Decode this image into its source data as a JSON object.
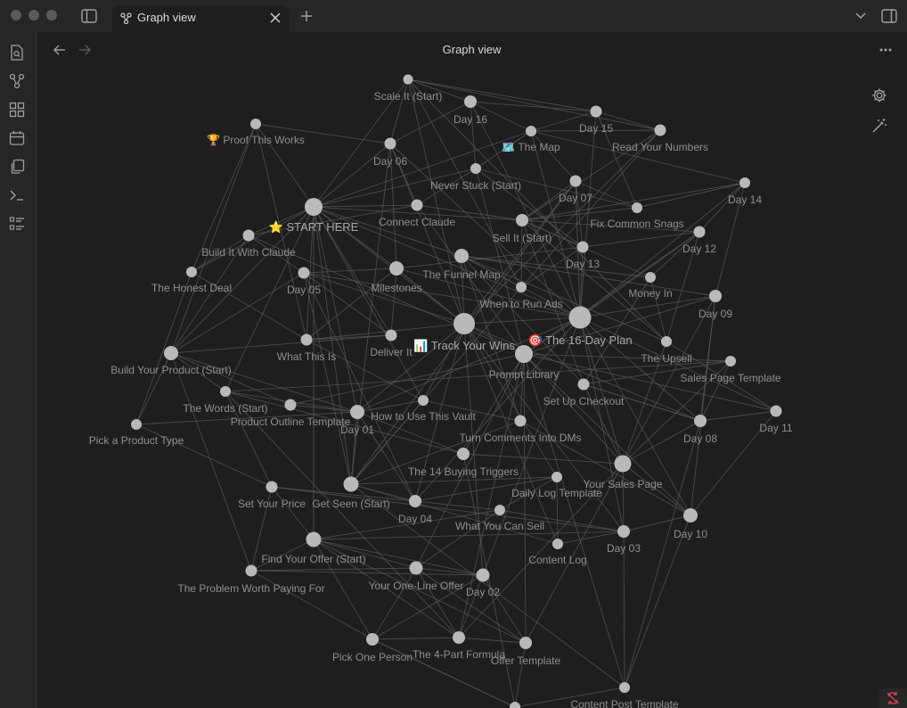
{
  "window": {
    "tab_title": "Graph view",
    "view_title": "Graph view"
  },
  "icons": {
    "tab_icon": "graph-icon",
    "close": "close-icon",
    "new_tab": "plus-icon",
    "sidebar_toggle_left": "sidebar-left-icon",
    "tab_list": "chevron-down-icon",
    "sidebar_toggle_right": "sidebar-right-icon",
    "back": "arrow-left-icon",
    "forward": "arrow-right-icon",
    "more": "more-horizontal-icon",
    "settings": "gear-icon",
    "animate": "magic-wand-icon",
    "status": "sync-off-icon"
  },
  "ribbon": [
    {
      "name": "quick-switcher",
      "icon": "file-search-icon"
    },
    {
      "name": "graph-view",
      "icon": "graph-icon"
    },
    {
      "name": "canvas",
      "icon": "grid-icon"
    },
    {
      "name": "daily-note",
      "icon": "calendar-icon"
    },
    {
      "name": "templates",
      "icon": "copy-icon"
    },
    {
      "name": "command-palette",
      "icon": "terminal-icon"
    },
    {
      "name": "bases",
      "icon": "list-icon"
    }
  ],
  "colors": {
    "background": "#1e1e1e",
    "chrome": "#262626",
    "node": "#b9b9b9",
    "edge": "#5a5a5a",
    "label": "#8f8f8f",
    "sync_off": "#e0454f"
  },
  "graph": {
    "nodes": [
      {
        "id": "scale",
        "label": "Scale It (Start)"
      },
      {
        "id": "day16",
        "label": "Day 16"
      },
      {
        "id": "day15",
        "label": "Day 15"
      },
      {
        "id": "proof",
        "label": "🏆 Proof This Works"
      },
      {
        "id": "day06",
        "label": "Day 06"
      },
      {
        "id": "map",
        "label": "🗺️ The Map"
      },
      {
        "id": "readnum",
        "label": "Read Your Numbers"
      },
      {
        "id": "neverstuck",
        "label": "Never Stuck (Start)"
      },
      {
        "id": "day07",
        "label": "Day 07"
      },
      {
        "id": "day14",
        "label": "Day 14"
      },
      {
        "id": "start",
        "label": "⭐ START HERE"
      },
      {
        "id": "connect",
        "label": "Connect Claude"
      },
      {
        "id": "sellit",
        "label": "Sell It (Start)"
      },
      {
        "id": "fixsnags",
        "label": "Fix Common Snags"
      },
      {
        "id": "buildclaude",
        "label": "Build It With Claude"
      },
      {
        "id": "day12",
        "label": "Day 12"
      },
      {
        "id": "day13",
        "label": "Day 13"
      },
      {
        "id": "honest",
        "label": "The Honest Deal"
      },
      {
        "id": "day05",
        "label": "Day 05"
      },
      {
        "id": "milestones",
        "label": "Milestones"
      },
      {
        "id": "funnel",
        "label": "The Funnel Map"
      },
      {
        "id": "moneyin",
        "label": "Money In"
      },
      {
        "id": "runads",
        "label": "When to Run Ads"
      },
      {
        "id": "day09",
        "label": "Day 09"
      },
      {
        "id": "plan",
        "label": "🎯 The 16-Day Plan"
      },
      {
        "id": "trackwins",
        "label": "📊 Track Your Wins"
      },
      {
        "id": "whatthis",
        "label": "What This Is"
      },
      {
        "id": "deliver",
        "label": "Deliver It"
      },
      {
        "id": "upsell",
        "label": "The Upsell"
      },
      {
        "id": "buildproduct",
        "label": "Build Your Product (Start)"
      },
      {
        "id": "prompt",
        "label": "Prompt Library"
      },
      {
        "id": "salespagetpl",
        "label": "Sales Page Template"
      },
      {
        "id": "checkout",
        "label": "Set Up Checkout"
      },
      {
        "id": "words",
        "label": "The Words (Start)"
      },
      {
        "id": "outline",
        "label": "Product Outline Template"
      },
      {
        "id": "vault",
        "label": "How to Use This Vault"
      },
      {
        "id": "day01",
        "label": "Day 01"
      },
      {
        "id": "day11",
        "label": "Day 11"
      },
      {
        "id": "pickproduct",
        "label": "Pick a Product Type"
      },
      {
        "id": "comments",
        "label": "Turn Comments Into DMs"
      },
      {
        "id": "day08",
        "label": "Day 08"
      },
      {
        "id": "triggers",
        "label": "The 14 Buying Triggers"
      },
      {
        "id": "yoursales",
        "label": "Your Sales Page"
      },
      {
        "id": "dailylog",
        "label": "Daily Log Template"
      },
      {
        "id": "setprice",
        "label": "Set Your Price"
      },
      {
        "id": "getseen",
        "label": "Get Seen (Start)"
      },
      {
        "id": "day04",
        "label": "Day 04"
      },
      {
        "id": "whatsell",
        "label": "What You Can Sell"
      },
      {
        "id": "day03",
        "label": "Day 03"
      },
      {
        "id": "day10",
        "label": "Day 10"
      },
      {
        "id": "findoffer",
        "label": "Find Your Offer (Start)"
      },
      {
        "id": "contentlog",
        "label": "Content Log"
      },
      {
        "id": "problem",
        "label": "The Problem Worth Paying For"
      },
      {
        "id": "oneline",
        "label": "Your One-Line Offer"
      },
      {
        "id": "day02",
        "label": "Day 02"
      },
      {
        "id": "pickone",
        "label": "Pick One Person"
      },
      {
        "id": "formula",
        "label": "The 4-Part Formula"
      },
      {
        "id": "offertpl",
        "label": "Offer Template"
      },
      {
        "id": "contentpost",
        "label": "Content Post Template"
      },
      {
        "id": "bottom",
        "label": ""
      }
    ]
  }
}
